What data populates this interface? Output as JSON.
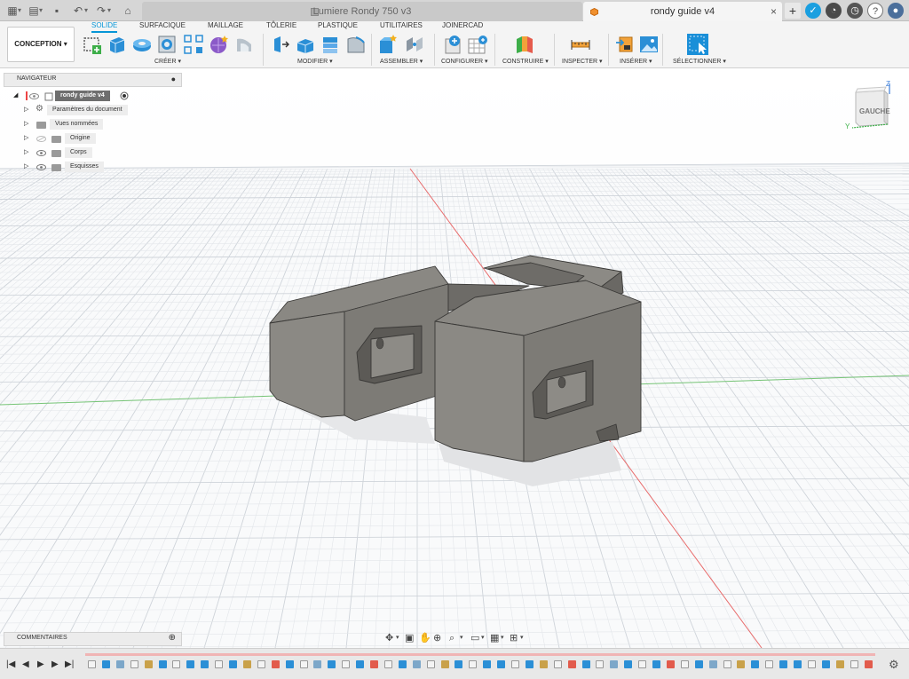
{
  "titlebar": {
    "tab_inactive": "Lumiere Rondy 750 v3",
    "tab_active": "rondy guide v4",
    "close_symbol": "×",
    "new_tab_symbol": "+",
    "icons": [
      "app-grid-icon",
      "file-icon",
      "save-icon",
      "undo-icon",
      "redo-icon",
      "home-icon",
      "extensions-icon",
      "notifications-icon",
      "help-icon",
      "avatar-icon"
    ],
    "accent": "#0696d7"
  },
  "toolbar": {
    "workspace_button": "CONCEPTION ▾",
    "workspace_tabs": [
      "SOLIDE",
      "SURFACIQUE",
      "MAILLAGE",
      "TÔLERIE",
      "PLASTIQUE",
      "UTILITAIRES",
      "JOINERCAD"
    ],
    "active_tab": "SOLIDE",
    "groups": [
      "CRÉER ▾",
      "MODIFIER ▾",
      "ASSEMBLER ▾",
      "CONFIGURER ▾",
      "CONSTRUIRE ▾",
      "INSPECTER ▾",
      "INSÉRER ▾",
      "SÉLECTIONNER ▾"
    ]
  },
  "navigator": {
    "title": "NAVIGATEUR",
    "collapse_symbol": "●",
    "root": "rondy guide v4",
    "items": [
      "Paramètres du document",
      "Vues nommées",
      "Origine",
      "Corps",
      "Esquisses"
    ]
  },
  "viewcube": {
    "face": "GAUCHE",
    "axis_z": "Z",
    "axis_y": "Y"
  },
  "comments": {
    "title": "COMMENTAIRES",
    "add_symbol": "⊕"
  },
  "timeline": {
    "controls": [
      "|◀",
      "◀",
      "▶",
      "▶",
      "▶|"
    ],
    "settings_icon": "⚙"
  },
  "colors": {
    "part_face": "#7d7b76",
    "part_top": "#8a8883",
    "grid_minor": "#e3e6ea",
    "grid_major": "#cfd4da",
    "axis_red": "#e86a6a",
    "axis_green": "#76c476"
  }
}
